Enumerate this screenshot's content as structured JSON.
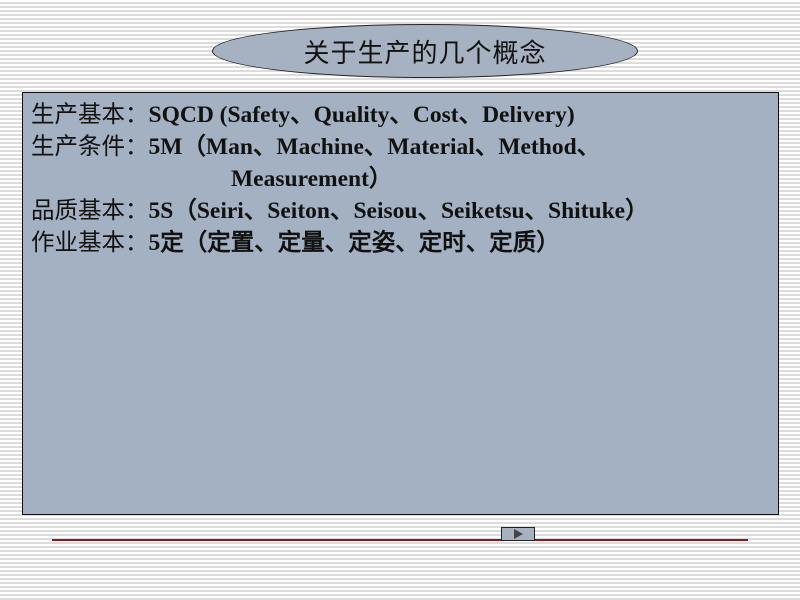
{
  "slide": {
    "title": "关于生产的几个概念",
    "lines": [
      {
        "label": "生产基本：",
        "value": "SQCD (Safety、Quality、Cost、Delivery)"
      },
      {
        "label": "生产条件：",
        "value": "5M（Man、Machine、Material、Method、"
      },
      {
        "label": "",
        "value": "Measurement）"
      },
      {
        "label": "品质基本：",
        "value": "5S（Seiri、Seiton、Seisou、Seiketsu、Shituke）"
      },
      {
        "label": "作业基本：",
        "value": "5定（定置、定量、定姿、定时、定质）"
      }
    ]
  },
  "navigation": {
    "next_icon": "play-icon",
    "divider_color": "#8b1a1a"
  },
  "colors": {
    "panel_bg": "#a3b1c2",
    "title_bg": "#a6b2c2"
  }
}
